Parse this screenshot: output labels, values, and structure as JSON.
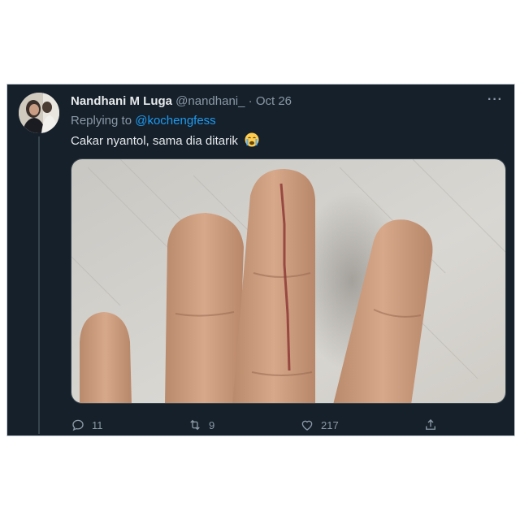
{
  "tweet": {
    "author_name": "Nandhani M Luga",
    "author_handle": "@nandhani_",
    "separator": "·",
    "date": "Oct 26",
    "more_icon": "more-horizontal-icon",
    "replying_prefix": "Replying to",
    "replying_to": "@kochengfess",
    "text": "Cakar nyantol, sama dia ditarik",
    "text_emoji": "crying-face-emoji",
    "media_alt": "photo-of-fingers-with-scratch",
    "actions": {
      "reply_count": "11",
      "retweet_count": "9",
      "like_count": "217"
    }
  },
  "colors": {
    "card_bg": "#15202b",
    "text_primary": "#e7e9ea",
    "text_secondary": "#8b98a5",
    "link": "#1d9bf0"
  }
}
